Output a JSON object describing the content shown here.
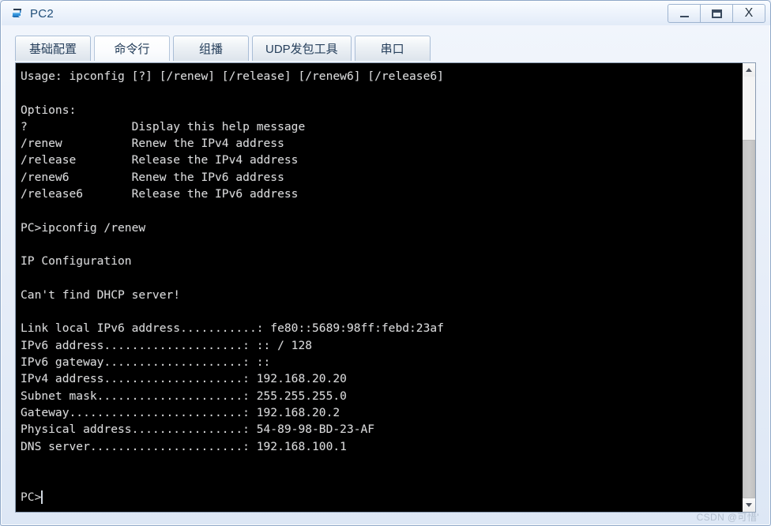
{
  "window": {
    "title": "PC2",
    "icon": "pc-device-icon",
    "controls": {
      "minimize": "—",
      "maximize": "❐",
      "close": "X",
      "minimize_name": "minimize-button",
      "maximize_name": "maximize-button",
      "close_name": "close-button"
    }
  },
  "tabs": [
    {
      "label": "基础配置",
      "name": "tab-basic-config",
      "active": false
    },
    {
      "label": "命令行",
      "name": "tab-command-line",
      "active": true
    },
    {
      "label": "组播",
      "name": "tab-multicast",
      "active": false
    },
    {
      "label": "UDP发包工具",
      "name": "tab-udp-tool",
      "active": false
    },
    {
      "label": "串口",
      "name": "tab-serial-port",
      "active": false
    }
  ],
  "terminal": {
    "content": "Usage: ipconfig [?] [/renew] [/release] [/renew6] [/release6]\n\nOptions:\n?               Display this help message\n/renew          Renew the IPv4 address\n/release        Release the IPv4 address\n/renew6         Renew the IPv6 address\n/release6       Release the IPv6 address\n\nPC>ipconfig /renew\n\nIP Configuration\n\nCan't find DHCP server!\n\nLink local IPv6 address...........: fe80::5689:98ff:febd:23af\nIPv6 address....................: :: / 128\nIPv6 gateway....................: ::\nIPv4 address....................: 192.168.20.20\nSubnet mask.....................: 255.255.255.0\nGateway.........................: 192.168.20.2\nPhysical address................: 54-89-98-BD-23-AF\nDNS server......................: 192.168.100.1",
    "prompt": "PC>",
    "background_color": "#000000",
    "text_color": "#d9d9d9",
    "command_entered": "ipconfig /renew",
    "ip_config": {
      "link_local_ipv6_address": "fe80::5689:98ff:febd:23af",
      "ipv6_address": ":: / 128",
      "ipv6_gateway": "::",
      "ipv4_address": "192.168.20.20",
      "subnet_mask": "255.255.255.0",
      "gateway": "192.168.20.2",
      "physical_address": "54-89-98-BD-23-AF",
      "dns_server": "192.168.100.1",
      "status_message": "Can't find DHCP server!"
    }
  },
  "scrollbar": {
    "up_arrow": "scroll-up-arrow",
    "down_arrow": "scroll-down-arrow"
  },
  "watermark": "CSDN @可惜'"
}
